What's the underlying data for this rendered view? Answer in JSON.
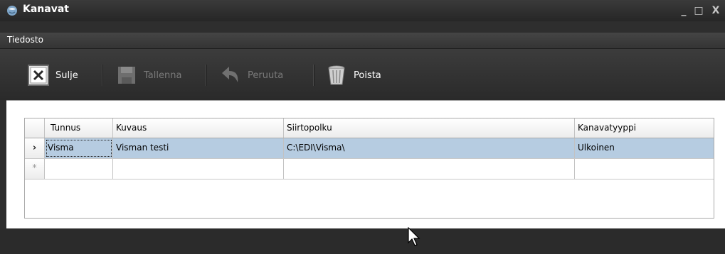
{
  "window": {
    "title": "Kanavat",
    "controls": {
      "minimize": "_",
      "maximize": "□",
      "close": "X"
    }
  },
  "menu": {
    "items": [
      {
        "label": "Tiedosto"
      }
    ]
  },
  "toolbar": {
    "buttons": [
      {
        "label": "Sulje",
        "icon": "close-box-icon",
        "enabled": true
      },
      {
        "label": "Tallenna",
        "icon": "save-disk-icon",
        "enabled": false
      },
      {
        "label": "Peruuta",
        "icon": "undo-arrow-icon",
        "enabled": false
      },
      {
        "label": "Poista",
        "icon": "trash-bin-icon",
        "enabled": true
      }
    ]
  },
  "grid": {
    "columns": [
      "Tunnus",
      "Kuvaus",
      "Siirtopolku",
      "Kanavatyyppi"
    ],
    "rows": [
      {
        "marker": "›",
        "cells": [
          "Visma",
          "Visman testi",
          "C:\\EDI\\Visma\\",
          "Ulkoinen"
        ],
        "selected": true
      }
    ],
    "new_row_marker": "*"
  },
  "colors": {
    "selected_row": "#b6cce1",
    "titlebar": "#262626",
    "panel": "#ffffff"
  }
}
